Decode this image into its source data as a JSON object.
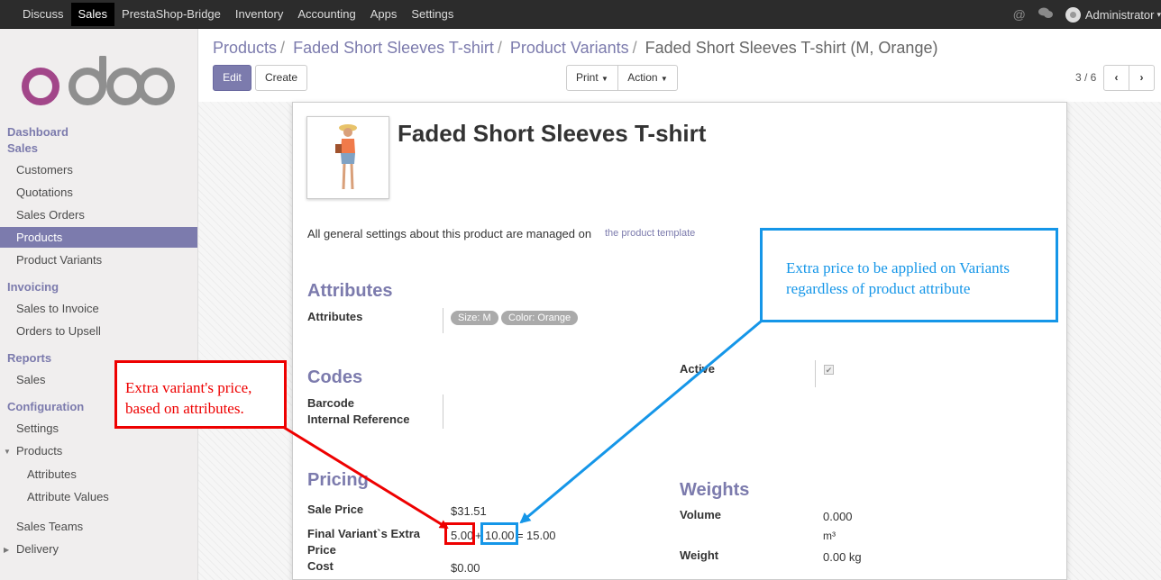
{
  "topbar": {
    "menu": [
      "Discuss",
      "Sales",
      "PrestaShop-Bridge",
      "Inventory",
      "Accounting",
      "Apps",
      "Settings"
    ],
    "active": "Sales",
    "user": "Administrator"
  },
  "sidebar": {
    "logo_text": "odoo",
    "dashboard": "Dashboard",
    "sales_header": "Sales",
    "sales_items": [
      "Customers",
      "Quotations",
      "Sales Orders",
      "Products",
      "Product Variants"
    ],
    "invoicing_header": "Invoicing",
    "invoicing_items": [
      "Sales to Invoice",
      "Orders to Upsell"
    ],
    "reports_header": "Reports",
    "reports_items": [
      "Sales"
    ],
    "config_header": "Configuration",
    "config_items": [
      "Settings",
      "Products",
      "Attributes",
      "Attribute Values",
      "Sales Teams",
      "Delivery"
    ]
  },
  "breadcrumb": {
    "items": [
      "Products",
      "Faded Short Sleeves T-shirt",
      "Product Variants"
    ],
    "current": "Faded Short Sleeves T-shirt (M, Orange)",
    "separator": "/"
  },
  "controls": {
    "edit": "Edit",
    "create": "Create",
    "print": "Print",
    "action": "Action",
    "pager": "3 / 6"
  },
  "form": {
    "product_name": "Faded Short Sleeves T-shirt",
    "info_text": "All general settings about this product are managed on",
    "template_link": "the product template",
    "attributes_section": "Attributes",
    "attributes_label": "Attributes",
    "attribute_tags": [
      "Size: M",
      "Color: Orange"
    ],
    "codes_section": "Codes",
    "barcode_label": "Barcode",
    "internal_ref_label": "Internal Reference",
    "active_label": "Active",
    "pricing_section": "Pricing",
    "sale_price_label": "Sale Price",
    "sale_price": "$31.51",
    "extra_label_1": "Final Variant`s Extra",
    "extra_label_2": "Price",
    "extra_a": "5.00",
    "extra_plus": "+",
    "extra_b": "10.00",
    "extra_eq": "=",
    "extra_total": "15.00",
    "cost_label": "Cost",
    "cost": "$0.00",
    "weights_section": "Weights",
    "volume_label": "Volume",
    "volume": "0.000",
    "volume_unit": "m³",
    "weight_label": "Weight",
    "weight": "0.00 kg"
  },
  "annotations": {
    "red_line1": "Extra variant's price,",
    "red_line2": "based on attributes.",
    "blue_line1": "Extra price to be applied on Variants",
    "blue_line2": "regardless of product attribute",
    "red_color": "#e00000",
    "blue_color": "#1596e8"
  }
}
